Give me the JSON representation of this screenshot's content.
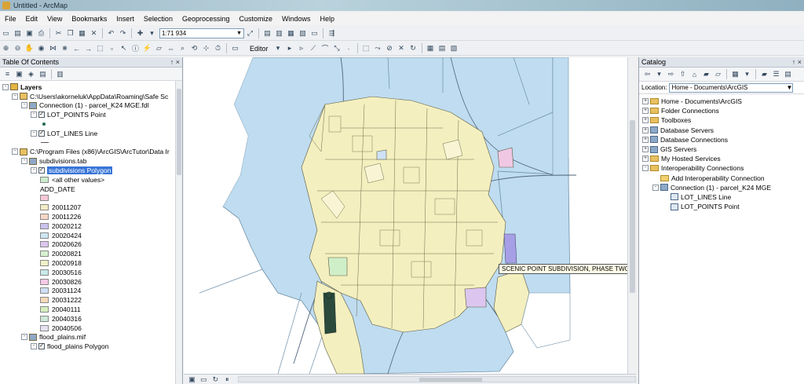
{
  "window": {
    "title": "Untitled - ArcMap"
  },
  "menu": [
    "File",
    "Edit",
    "View",
    "Bookmarks",
    "Insert",
    "Selection",
    "Geoprocessing",
    "Customize",
    "Windows",
    "Help"
  ],
  "toolbar": {
    "scale": "1:71 934",
    "editor_label": "Editor"
  },
  "toc": {
    "title": "Table Of Contents",
    "controls": "↑ ×",
    "rows": [
      {
        "indent": 0,
        "exp": "-",
        "icon": "layers",
        "label": "Layers",
        "bold": true
      },
      {
        "indent": 1,
        "exp": "-",
        "icon": "folder",
        "label": "C:\\Users\\akorneluk\\AppData\\Roaming\\Safe Sc"
      },
      {
        "indent": 2,
        "exp": "-",
        "icon": "db",
        "label": "Connection (1) - parcel_K24 MGE.fdl"
      },
      {
        "indent": 3,
        "exp": "-",
        "chk": true,
        "label": "LOT_POINTS Point"
      },
      {
        "indent": 4,
        "sym": "point",
        "label": ""
      },
      {
        "indent": 3,
        "exp": "-",
        "chk": true,
        "label": "LOT_LINES Line"
      },
      {
        "indent": 4,
        "sym": "line",
        "label": ""
      },
      {
        "indent": 1,
        "exp": "-",
        "icon": "folder",
        "label": "C:\\Program Files (x86)\\ArcGIS\\ArcTutor\\Data Ir"
      },
      {
        "indent": 2,
        "exp": "-",
        "icon": "db",
        "label": "subdivisions.tab"
      },
      {
        "indent": 3,
        "exp": "-",
        "chk": true,
        "label": "subdivisions Polygon",
        "selected": true
      },
      {
        "indent": 4,
        "swatch": "#cdeccd",
        "label": "<all other values>"
      },
      {
        "indent": 4,
        "label": "ADD_DATE"
      },
      {
        "indent": 4,
        "swatch": "#f7c8d8",
        "label": ""
      },
      {
        "indent": 4,
        "swatch": "#f3ecc4",
        "label": "20011207"
      },
      {
        "indent": 4,
        "swatch": "#f6d7c6",
        "label": "20011226"
      },
      {
        "indent": 4,
        "swatch": "#c9c3ee",
        "label": "20020212"
      },
      {
        "indent": 4,
        "swatch": "#cde6f3",
        "label": "20020424"
      },
      {
        "indent": 4,
        "swatch": "#dcc6ef",
        "label": "20020626"
      },
      {
        "indent": 4,
        "swatch": "#d6f0d0",
        "label": "20020821"
      },
      {
        "indent": 4,
        "swatch": "#f2f2c8",
        "label": "20020918"
      },
      {
        "indent": 4,
        "swatch": "#c9e9ea",
        "label": "20030516"
      },
      {
        "indent": 4,
        "swatch": "#f4c9e6",
        "label": "20030826"
      },
      {
        "indent": 4,
        "swatch": "#cfdff3",
        "label": "20031124"
      },
      {
        "indent": 4,
        "swatch": "#f6d9b8",
        "label": "20031222"
      },
      {
        "indent": 4,
        "swatch": "#d5eebf",
        "label": "20040111"
      },
      {
        "indent": 4,
        "swatch": "#cfe8d7",
        "label": "20040316"
      },
      {
        "indent": 4,
        "swatch": "#e6e2f2",
        "label": "20040506"
      },
      {
        "indent": 2,
        "exp": "-",
        "icon": "db",
        "label": "flood_plains.mif"
      },
      {
        "indent": 3,
        "exp": "-",
        "chk": true,
        "label": "flood_plains Polygon"
      }
    ]
  },
  "map": {
    "tooltip": "SCENIC POINT SUBDIVISION, PHASE TWO"
  },
  "catalog": {
    "title": "Catalog",
    "controls": "↑ ×",
    "location_label": "Location:",
    "location_value": "Home - Documents\\ArcGIS",
    "items": [
      {
        "level": 0,
        "exp": "+",
        "icon": "folder",
        "label": "Home - Documents\\ArcGIS"
      },
      {
        "level": 0,
        "exp": "+",
        "icon": "folder",
        "label": "Folder Connections"
      },
      {
        "level": 0,
        "exp": "+",
        "icon": "folder",
        "label": "Toolboxes"
      },
      {
        "level": 0,
        "exp": "+",
        "icon": "db",
        "label": "Database Servers"
      },
      {
        "level": 0,
        "exp": "+",
        "icon": "db",
        "label": "Database Connections"
      },
      {
        "level": 0,
        "exp": "+",
        "icon": "db",
        "label": "GIS Servers"
      },
      {
        "level": 0,
        "exp": "+",
        "icon": "folder",
        "label": "My Hosted Services"
      },
      {
        "level": 0,
        "exp": "-",
        "icon": "folder",
        "label": "Interoperability Connections"
      },
      {
        "level": 1,
        "exp": "",
        "icon": "add",
        "label": "Add Interoperability Connection"
      },
      {
        "level": 1,
        "exp": "-",
        "icon": "db",
        "label": "Connection (1) - parcel_K24 MGE"
      },
      {
        "level": 2,
        "exp": "",
        "icon": "layer",
        "label": "LOT_LINES Line"
      },
      {
        "level": 2,
        "exp": "",
        "icon": "layer",
        "label": "LOT_POINTS Point"
      }
    ]
  }
}
